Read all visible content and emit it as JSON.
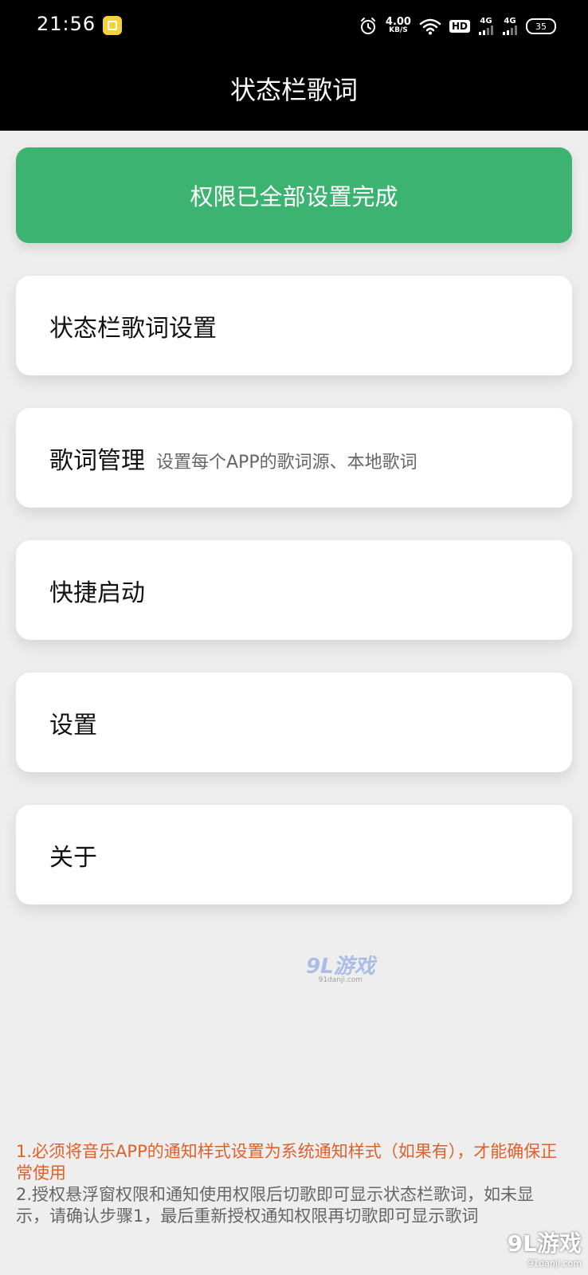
{
  "status_bar": {
    "time": "21:56",
    "speed_value": "4.00",
    "speed_unit": "KB/S",
    "hd_label": "HD",
    "network_1": "4G",
    "network_2": "4G",
    "battery": "35",
    "icons": [
      "app-notification-icon",
      "alarm-icon",
      "wifi-icon",
      "hd-icon",
      "signal-icon",
      "signal-icon",
      "battery-icon"
    ]
  },
  "app_bar": {
    "title": "状态栏歌词"
  },
  "permission_button": {
    "label": "权限已全部设置完成",
    "color": "#3cb371"
  },
  "menu": {
    "items": [
      {
        "label": "状态栏歌词设置",
        "sub": ""
      },
      {
        "label": "歌词管理",
        "sub": "设置每个APP的歌词源、本地歌词"
      },
      {
        "label": "快捷启动",
        "sub": ""
      },
      {
        "label": "设置",
        "sub": ""
      },
      {
        "label": "关于",
        "sub": ""
      }
    ]
  },
  "watermark": {
    "center_logo": "9L游戏",
    "center_url": "91danji.com",
    "corner_logo": "9L游戏",
    "corner_url": "91danji.com"
  },
  "notes": {
    "note_1": "1.必须将音乐APP的通知样式设置为系统通知样式（如果有），才能确保正常使用",
    "note_2": "2.授权悬浮窗权限和通知使用权限后切歌即可显示状态栏歌词，如未显示，请确认步骤1，最后重新授权通知权限再切歌即可显示歌词",
    "note_1_color": "#e0602a"
  }
}
